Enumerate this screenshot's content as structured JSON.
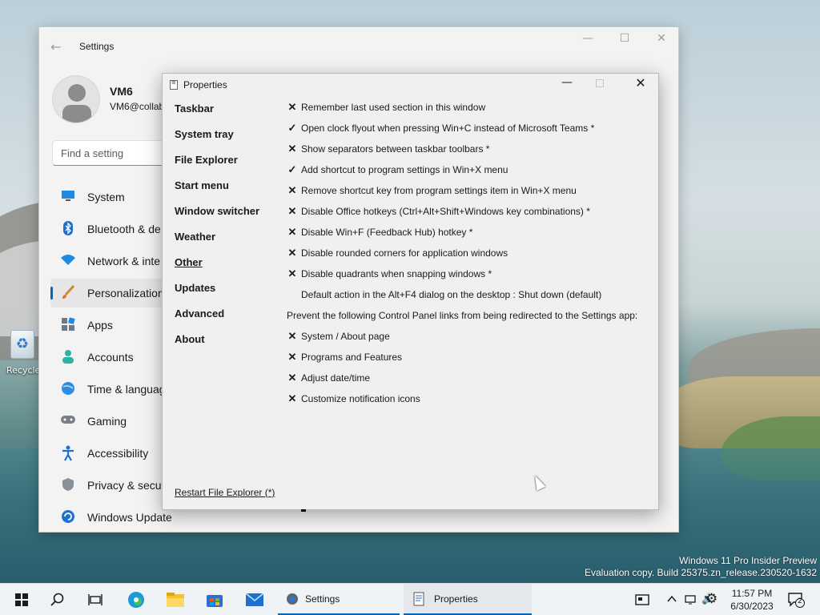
{
  "settings": {
    "title": "Settings",
    "back_glyph": "←",
    "user_name": "VM6",
    "user_email": "VM6@collab",
    "search_placeholder": "Find a setting",
    "nav": [
      {
        "label": "System",
        "icon": "display-icon"
      },
      {
        "label": "Bluetooth & de",
        "icon": "bluetooth-icon"
      },
      {
        "label": "Network & inte",
        "icon": "wifi-icon"
      },
      {
        "label": "Personalization",
        "icon": "brush-icon",
        "selected": true
      },
      {
        "label": "Apps",
        "icon": "apps-icon"
      },
      {
        "label": "Accounts",
        "icon": "accounts-icon"
      },
      {
        "label": "Time & languag",
        "icon": "globe-icon"
      },
      {
        "label": "Gaming",
        "icon": "gamepad-icon"
      },
      {
        "label": "Accessibility",
        "icon": "accessibility-icon"
      },
      {
        "label": "Privacy & secur",
        "icon": "shield-icon"
      },
      {
        "label": "Windows Update",
        "icon": "update-icon"
      }
    ]
  },
  "properties": {
    "title": "Properties",
    "sections": [
      "Taskbar",
      "System tray",
      "File Explorer",
      "Start menu",
      "Window switcher",
      "Weather",
      "Other",
      "Updates",
      "Advanced",
      "About"
    ],
    "active_section": "Other",
    "options": [
      {
        "mark": "✕",
        "text": "Remember last used section in this window"
      },
      {
        "mark": "✓",
        "text": "Open clock flyout when pressing Win+C instead of Microsoft Teams *"
      },
      {
        "mark": "✕",
        "text": "Show separators between taskbar toolbars *"
      },
      {
        "mark": "✓",
        "text": "Add shortcut to program settings in Win+X menu"
      },
      {
        "mark": "✕",
        "text": "Remove shortcut key from program settings item in Win+X menu"
      },
      {
        "mark": "✕",
        "text": "Disable Office hotkeys (Ctrl+Alt+Shift+Windows key combinations) *"
      },
      {
        "mark": "✕",
        "text": "Disable Win+F (Feedback Hub) hotkey *"
      },
      {
        "mark": "✕",
        "text": "Disable rounded corners for application windows"
      },
      {
        "mark": "✕",
        "text": "Disable quadrants when snapping windows *"
      },
      {
        "mark": "",
        "text": "Default action in the Alt+F4 dialog on the desktop : Shut down (default)"
      }
    ],
    "redirect_heading": "Prevent the following Control Panel links from being redirected to the Settings app:",
    "redirect_options": [
      {
        "mark": "✕",
        "text": "System / About page"
      },
      {
        "mark": "✕",
        "text": "Programs and Features"
      },
      {
        "mark": "✕",
        "text": "Adjust date/time"
      },
      {
        "mark": "✕",
        "text": "Customize notification icons"
      }
    ],
    "restart_link": "Restart File Explorer (*)"
  },
  "desktop": {
    "recycle_label": "Recycle",
    "watermark_line1": "Windows 11 Pro Insider Preview",
    "watermark_line2": "Evaluation copy. Build 25375.zn_release.230520-1632"
  },
  "taskbar": {
    "settings_label": "Settings",
    "properties_label": "Properties",
    "time": "11:57 PM",
    "date": "6/30/2023",
    "notification_count": "2",
    "accent": "#0067c0"
  }
}
